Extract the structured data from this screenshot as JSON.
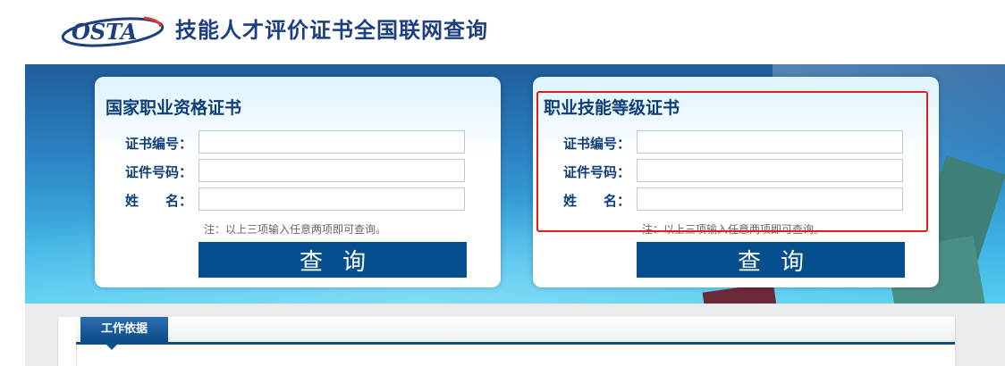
{
  "header": {
    "logo_text": "OSTA",
    "title": "技能人才评价证书全国联网查询"
  },
  "cards": [
    {
      "title": "国家职业资格证书",
      "fields": [
        {
          "label": "证书编号：",
          "value": "",
          "placeholder": ""
        },
        {
          "label": "证件号码：",
          "value": "",
          "placeholder": ""
        },
        {
          "label": "姓　　名：",
          "value": "",
          "placeholder": ""
        }
      ],
      "note": "注：以上三项输入任意两项即可查询。",
      "button_label": "查询"
    },
    {
      "title": "职业技能等级证书",
      "fields": [
        {
          "label": "证书编号：",
          "value": "",
          "placeholder": ""
        },
        {
          "label": "证件号码：",
          "value": "",
          "placeholder": ""
        },
        {
          "label": "姓　　名：",
          "value": "",
          "placeholder": ""
        }
      ],
      "note": "注：以上三项输入任意两项即可查询。",
      "button_label": "查询"
    }
  ],
  "lower": {
    "tab_label": "工作依据"
  },
  "colors": {
    "brand": "#1d3f7e",
    "button": "#064f8e",
    "highlight": "#e11d1d"
  }
}
